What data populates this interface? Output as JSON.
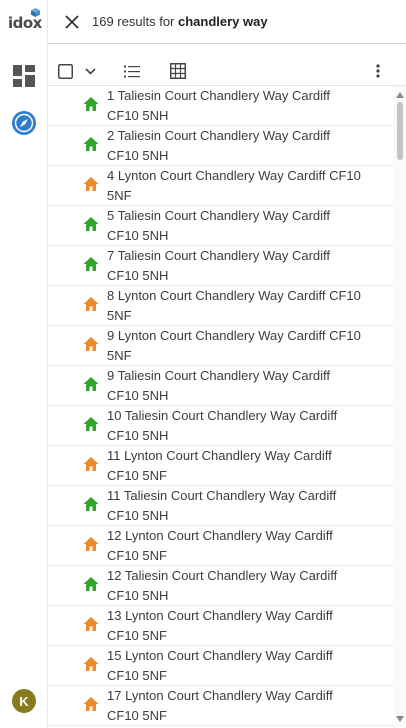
{
  "app": {
    "logo_text": "idox",
    "avatar_initial": "K",
    "colors": {
      "green_house": "#2fa52f",
      "orange_house": "#ef8b2c",
      "compass_blue": "#2f7ec9",
      "avatar": "#8a7a1e"
    }
  },
  "sidebar": {
    "icons": [
      "dashboard-icon",
      "compass-icon"
    ]
  },
  "search": {
    "results_prefix": "169 results for",
    "query": "chandlery way"
  },
  "toolbar": {
    "icons": [
      "checkbox-icon",
      "chevron-down-icon",
      "list-view-icon",
      "grid-view-icon",
      "more-vert-icon"
    ]
  },
  "results": [
    {
      "line1": "1 Taliesin Court Chandlery Way Cardiff",
      "line2": "CF10 5NH",
      "color": "green"
    },
    {
      "line1": "2 Taliesin Court Chandlery Way Cardiff",
      "line2": "CF10 5NH",
      "color": "green"
    },
    {
      "line1": "4 Lynton Court Chandlery Way Cardiff CF10",
      "line2": "5NF",
      "color": "orange"
    },
    {
      "line1": "5 Taliesin Court Chandlery Way Cardiff",
      "line2": "CF10 5NH",
      "color": "green"
    },
    {
      "line1": "7 Taliesin Court Chandlery Way Cardiff",
      "line2": "CF10 5NH",
      "color": "green"
    },
    {
      "line1": "8 Lynton Court Chandlery Way Cardiff CF10",
      "line2": "5NF",
      "color": "orange"
    },
    {
      "line1": "9 Lynton Court Chandlery Way Cardiff CF10",
      "line2": "5NF",
      "color": "orange"
    },
    {
      "line1": "9 Taliesin Court Chandlery Way Cardiff",
      "line2": "CF10 5NH",
      "color": "green"
    },
    {
      "line1": "10 Taliesin Court Chandlery Way Cardiff",
      "line2": "CF10 5NH",
      "color": "green"
    },
    {
      "line1": "11 Lynton Court Chandlery Way Cardiff",
      "line2": "CF10 5NF",
      "color": "orange"
    },
    {
      "line1": "11 Taliesin Court Chandlery Way Cardiff",
      "line2": "CF10 5NH",
      "color": "green"
    },
    {
      "line1": "12 Lynton Court Chandlery Way Cardiff",
      "line2": "CF10 5NF",
      "color": "orange"
    },
    {
      "line1": "12 Taliesin Court Chandlery Way Cardiff",
      "line2": "CF10 5NH",
      "color": "green"
    },
    {
      "line1": "13 Lynton Court Chandlery Way Cardiff",
      "line2": "CF10 5NF",
      "color": "orange"
    },
    {
      "line1": "15 Lynton Court Chandlery Way Cardiff",
      "line2": "CF10 5NF",
      "color": "orange"
    },
    {
      "line1": "17 Lynton Court Chandlery Way Cardiff",
      "line2": "CF10 5NF",
      "color": "orange"
    }
  ]
}
